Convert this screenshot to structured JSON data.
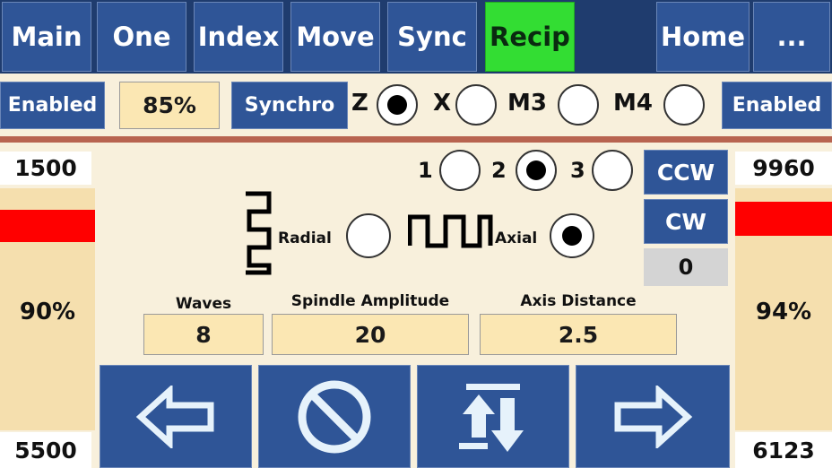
{
  "tabs": [
    {
      "label": "Main"
    },
    {
      "label": "One"
    },
    {
      "label": "Index"
    },
    {
      "label": "Move"
    },
    {
      "label": "Sync"
    },
    {
      "label": "Recip"
    },
    {
      "label": ""
    },
    {
      "label": "Home"
    },
    {
      "label": "..."
    }
  ],
  "active_tab": "Recip",
  "row2": {
    "enabled_left": "Enabled",
    "percent": "85%",
    "synchro": "Synchro",
    "axes": [
      {
        "label": "Z",
        "selected": true
      },
      {
        "label": "X",
        "selected": false
      },
      {
        "label": "M3",
        "selected": false
      },
      {
        "label": "M4",
        "selected": false
      }
    ],
    "enabled_right": "Enabled"
  },
  "left": {
    "top_value": "1500",
    "percent": "90%",
    "bottom_value": "5500",
    "level": 0.9
  },
  "right": {
    "top_value": "9960",
    "percent": "94%",
    "bottom_value": "6123",
    "level": 0.94
  },
  "center": {
    "options": [
      {
        "label": "1",
        "selected": false
      },
      {
        "label": "2",
        "selected": true
      },
      {
        "label": "3",
        "selected": false
      }
    ],
    "ccw_label": "CCW",
    "cw_label": "CW",
    "counter": "0",
    "radial_label": "Radial",
    "axial_label": "Axial",
    "radial_selected": false,
    "axial_selected": true,
    "waves_label": "Waves",
    "waves_value": "8",
    "amplitude_label": "Spindle Amplitude",
    "amplitude_value": "20",
    "distance_label": "Axis Distance",
    "distance_value": "2.5"
  },
  "nav": {
    "icons": [
      "arrow-left-icon",
      "stop-icon",
      "reverse-icon",
      "arrow-right-icon"
    ]
  },
  "colors": {
    "tab_blue": "#2f5597",
    "active_green": "#33dd33",
    "background": "#f8f0dc",
    "value_box": "#fbe7b3",
    "red_bar": "#ff0000",
    "divider": "#b86450"
  }
}
